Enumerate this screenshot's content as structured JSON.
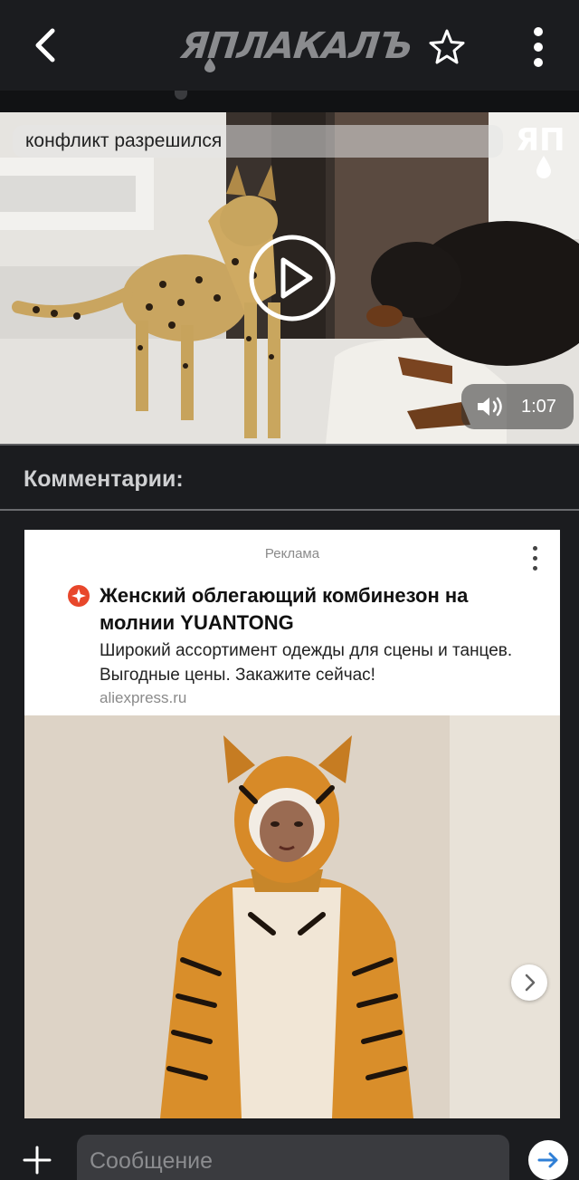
{
  "header": {
    "logo": "ЯПЛАКАЛЪ",
    "back_icon": "chevron-left-icon",
    "favorite_icon": "star-outline-icon",
    "menu_icon": "more-vertical-icon"
  },
  "video": {
    "title": "конфликт разрешился",
    "watermark": "ЯП",
    "duration": "1:07",
    "play_icon": "play-circle-icon",
    "sound_icon": "volume-icon"
  },
  "comments": {
    "title": "Комментарии:"
  },
  "ad": {
    "label": "Реклама",
    "title": "Женский облегающий комбинезон на молнии YUANTONG",
    "description": "Широкий ассортимент одежды для сцены и танцев. Выгодные цены. Закажите сейчас!",
    "domain": "aliexpress.ru",
    "brand_color": "#e8472b"
  },
  "composer": {
    "placeholder": "Сообщение",
    "send_color": "#2f7fd6"
  }
}
